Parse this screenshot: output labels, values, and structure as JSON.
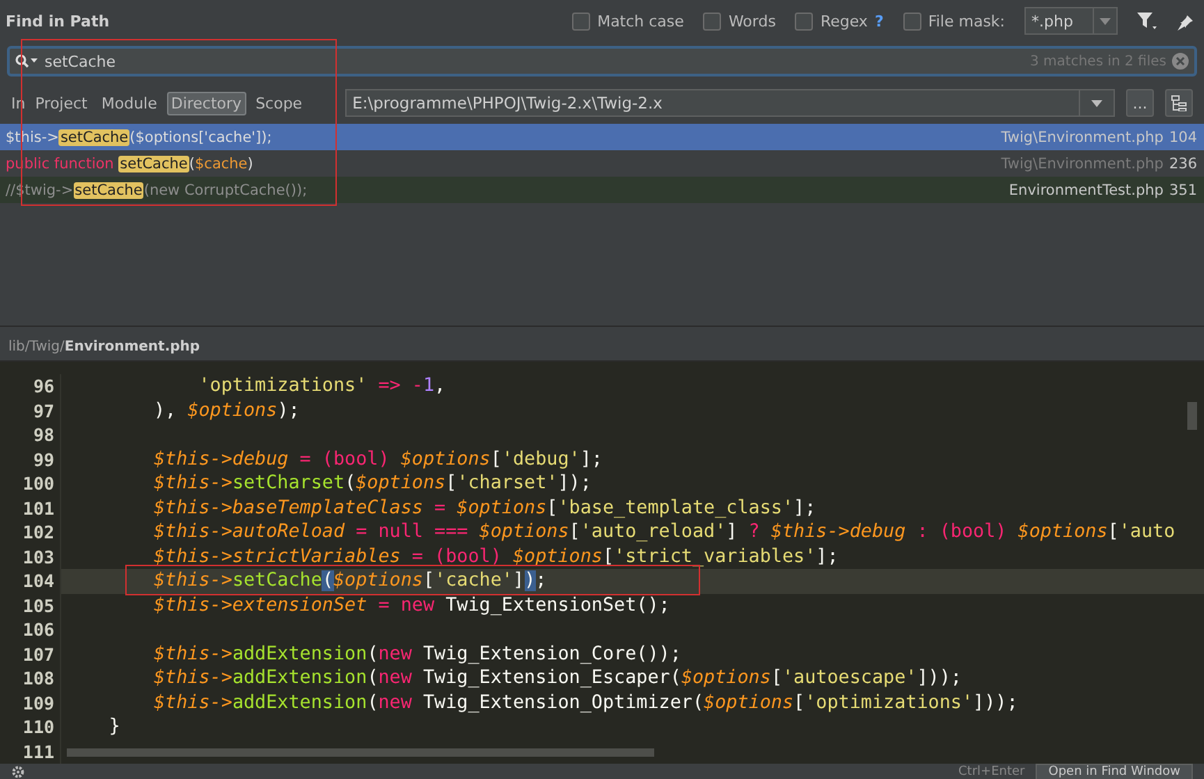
{
  "dialog": {
    "title": "Find in Path",
    "options": [
      {
        "label": "Match case",
        "checked": false
      },
      {
        "label": "Words",
        "checked": false
      },
      {
        "label": "Regex",
        "checked": false,
        "help": "?"
      },
      {
        "label": "File mask:",
        "checked": false
      }
    ],
    "file_mask": {
      "value": "*.php"
    },
    "search": {
      "value": "setCache",
      "match_count": "3 matches in 2 files"
    },
    "scope_label": "In",
    "scopes": [
      {
        "label": "Project",
        "selected": false
      },
      {
        "label": "Module",
        "selected": false
      },
      {
        "label": "Directory",
        "selected": true
      },
      {
        "label": "Scope",
        "selected": false
      }
    ],
    "directory": {
      "value": "E:\\programme\\PHPOJ\\Twig-2.x\\Twig-2.x"
    },
    "browse_button": "...",
    "results": [
      {
        "selected": true,
        "dim_file": false,
        "test": false,
        "segments": [
          {
            "kind": "plain",
            "text": "$this->"
          },
          {
            "kind": "match",
            "text": "setCache"
          },
          {
            "kind": "plain",
            "text": "($options['cache']);"
          }
        ],
        "file": "Twig\\Environment.php",
        "line": "104"
      },
      {
        "selected": false,
        "dim_file": true,
        "test": false,
        "segments": [
          {
            "kind": "keyword",
            "text": "public function "
          },
          {
            "kind": "match",
            "text": "setCache"
          },
          {
            "kind": "plain",
            "text": "("
          },
          {
            "kind": "var",
            "text": "$cache"
          },
          {
            "kind": "plain",
            "text": ")"
          }
        ],
        "file": "Twig\\Environment.php",
        "line": "236"
      },
      {
        "selected": false,
        "dim_file": false,
        "test": true,
        "segments": [
          {
            "kind": "comment",
            "text": "//$twig->"
          },
          {
            "kind": "match",
            "text": "setCache"
          },
          {
            "kind": "comment",
            "text": "(new CorruptCache());"
          }
        ],
        "file": "EnvironmentTest.php",
        "line": "351"
      }
    ]
  },
  "editor": {
    "path_dir": "lib/Twig/",
    "path_file": "Environment.php",
    "lines": [
      {
        "number": "96",
        "current": false,
        "tokens": [
          {
            "kind": "str",
            "text": "            'optimizations'"
          },
          {
            "kind": "op",
            "text": " => -"
          },
          {
            "kind": "num",
            "text": "1"
          },
          {
            "kind": "plain",
            "text": ","
          }
        ]
      },
      {
        "number": "97",
        "current": false,
        "tokens": [
          {
            "kind": "plain",
            "text": "        ), "
          },
          {
            "kind": "var",
            "text": "$options"
          },
          {
            "kind": "plain",
            "text": ");"
          }
        ]
      },
      {
        "number": "98",
        "current": false
      },
      {
        "number": "99",
        "current": false,
        "tokens": [
          {
            "kind": "var",
            "text": "        $this->debug"
          },
          {
            "kind": "op",
            "text": " = (bool) "
          },
          {
            "kind": "var",
            "text": "$options"
          },
          {
            "kind": "plain",
            "text": "["
          },
          {
            "kind": "str",
            "text": "'debug'"
          },
          {
            "kind": "plain",
            "text": "];"
          }
        ]
      },
      {
        "number": "100",
        "current": false,
        "tokens": [
          {
            "kind": "var",
            "text": "        $this->"
          },
          {
            "kind": "method",
            "text": "setCharset"
          },
          {
            "kind": "plain",
            "text": "("
          },
          {
            "kind": "var",
            "text": "$options"
          },
          {
            "kind": "plain",
            "text": "["
          },
          {
            "kind": "str",
            "text": "'charset'"
          },
          {
            "kind": "plain",
            "text": "]);"
          }
        ]
      },
      {
        "number": "101",
        "current": false,
        "tokens": [
          {
            "kind": "var",
            "text": "        $this->baseTemplateClass"
          },
          {
            "kind": "op",
            "text": " = "
          },
          {
            "kind": "var",
            "text": "$options"
          },
          {
            "kind": "plain",
            "text": "["
          },
          {
            "kind": "str",
            "text": "'base_template_class'"
          },
          {
            "kind": "plain",
            "text": "];"
          }
        ]
      },
      {
        "number": "102",
        "current": false,
        "tokens": [
          {
            "kind": "var",
            "text": "        $this->autoReload"
          },
          {
            "kind": "op",
            "text": " = null === "
          },
          {
            "kind": "var",
            "text": "$options"
          },
          {
            "kind": "plain",
            "text": "["
          },
          {
            "kind": "str",
            "text": "'auto_reload'"
          },
          {
            "kind": "plain",
            "text": "]"
          },
          {
            "kind": "op",
            "text": " ? "
          },
          {
            "kind": "var",
            "text": "$this->debug"
          },
          {
            "kind": "op",
            "text": " : (bool) "
          },
          {
            "kind": "var",
            "text": "$options"
          },
          {
            "kind": "plain",
            "text": "["
          },
          {
            "kind": "str",
            "text": "'auto"
          }
        ]
      },
      {
        "number": "103",
        "current": false,
        "tokens": [
          {
            "kind": "var",
            "text": "        $this->strictVariables"
          },
          {
            "kind": "op",
            "text": " = (bool) "
          },
          {
            "kind": "var",
            "text": "$options"
          },
          {
            "kind": "plain",
            "text": "["
          },
          {
            "kind": "str",
            "text": "'strict_variables'"
          },
          {
            "kind": "plain",
            "text": "];"
          }
        ]
      },
      {
        "number": "104",
        "current": true,
        "tokens": [
          {
            "kind": "var",
            "text": "        $this->"
          },
          {
            "kind": "method",
            "text": "setCache"
          },
          {
            "kind": "brace",
            "text": "("
          },
          {
            "kind": "var",
            "text": "$options"
          },
          {
            "kind": "plain",
            "text": "["
          },
          {
            "kind": "str",
            "text": "'cache'"
          },
          {
            "kind": "plain",
            "text": "]"
          },
          {
            "kind": "brace",
            "text": ")"
          },
          {
            "kind": "plain",
            "text": ";"
          }
        ]
      },
      {
        "number": "105",
        "current": false,
        "tokens": [
          {
            "kind": "var",
            "text": "        $this->extensionSet"
          },
          {
            "kind": "op",
            "text": " = new "
          },
          {
            "kind": "plain",
            "text": "Twig_ExtensionSet();"
          }
        ]
      },
      {
        "number": "106",
        "current": false
      },
      {
        "number": "107",
        "current": false,
        "tokens": [
          {
            "kind": "var",
            "text": "        $this->"
          },
          {
            "kind": "method",
            "text": "addExtension"
          },
          {
            "kind": "plain",
            "text": "("
          },
          {
            "kind": "op",
            "text": "new "
          },
          {
            "kind": "plain",
            "text": "Twig_Extension_Core());"
          }
        ]
      },
      {
        "number": "108",
        "current": false,
        "tokens": [
          {
            "kind": "var",
            "text": "        $this->"
          },
          {
            "kind": "method",
            "text": "addExtension"
          },
          {
            "kind": "plain",
            "text": "("
          },
          {
            "kind": "op",
            "text": "new "
          },
          {
            "kind": "plain",
            "text": "Twig_Extension_Escaper("
          },
          {
            "kind": "var",
            "text": "$options"
          },
          {
            "kind": "plain",
            "text": "["
          },
          {
            "kind": "str",
            "text": "'autoescape'"
          },
          {
            "kind": "plain",
            "text": "]));"
          }
        ]
      },
      {
        "number": "109",
        "current": false,
        "tokens": [
          {
            "kind": "var",
            "text": "        $this->"
          },
          {
            "kind": "method",
            "text": "addExtension"
          },
          {
            "kind": "plain",
            "text": "("
          },
          {
            "kind": "op",
            "text": "new "
          },
          {
            "kind": "plain",
            "text": "Twig_Extension_Optimizer("
          },
          {
            "kind": "var",
            "text": "$options"
          },
          {
            "kind": "plain",
            "text": "["
          },
          {
            "kind": "str",
            "text": "'optimizations'"
          },
          {
            "kind": "plain",
            "text": "]));"
          }
        ]
      },
      {
        "number": "110",
        "current": false,
        "tokens": [
          {
            "kind": "plain",
            "text": "    }"
          }
        ]
      },
      {
        "number": "111",
        "current": false
      }
    ]
  },
  "footer": {
    "shortcut": "Ctrl+Enter",
    "open_button": "Open in Find Window"
  }
}
